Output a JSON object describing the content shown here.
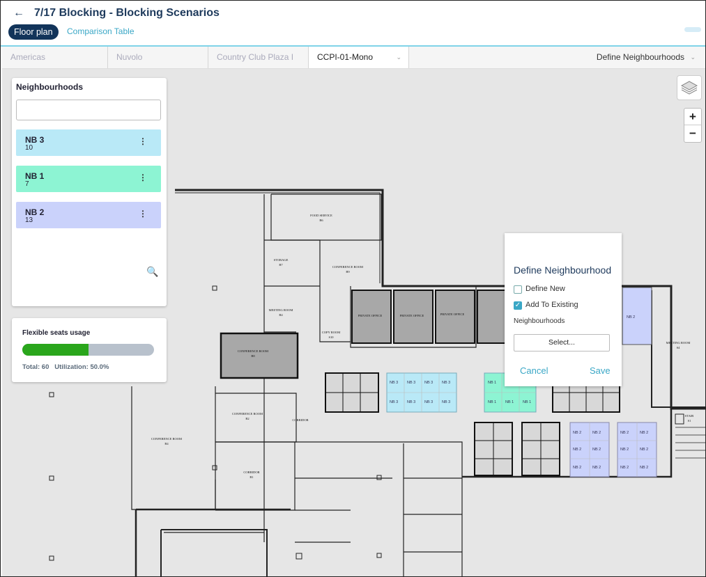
{
  "header": {
    "back_icon": "arrow-left-icon",
    "title": "7/17 Blocking - Blocking Scenarios",
    "tabs": [
      {
        "label": "Floor plan",
        "active": true
      },
      {
        "label": "Comparison Table",
        "active": false
      }
    ]
  },
  "breadcrumbs": {
    "items": [
      "Americas",
      "Nuvolo",
      "Country Club Plaza I"
    ],
    "floor": "CCPI-01-Mono",
    "mode": "Define Neighbourhoods"
  },
  "neighbourhoods": {
    "title": "Neighbourhoods",
    "search_value": "",
    "items": [
      {
        "name": "NB 3",
        "count": "10",
        "color": "#b9e9f7"
      },
      {
        "name": "NB 1",
        "count": "7",
        "color": "#8df4d3"
      },
      {
        "name": "NB 2",
        "count": "13",
        "color": "#cad2fb"
      }
    ]
  },
  "flexible_seats": {
    "title": "Flexible seats usage",
    "utilization_fraction": 0.5,
    "stats": "Total: 60   Utilization: 50.0%",
    "colors": {
      "used": "#2aa61c",
      "free": "#b8c1cc"
    }
  },
  "map_controls": {
    "layers_icon": "layers-icon",
    "zoom_in": "+",
    "zoom_out": "−"
  },
  "dialog": {
    "title": "Define Neighbourhood",
    "define_new_label": "Define New",
    "define_new_checked": false,
    "add_existing_label": "Add To Existing",
    "add_existing_checked": true,
    "neighbourhoods_label": "Neighbourhoods",
    "select_placeholder": "Select...",
    "cancel_label": "Cancel",
    "save_label": "Save"
  },
  "map_rooms": {
    "food_service": "FOOD SERVICE",
    "food_service_num": "B6",
    "storage": "STORAGE",
    "storage_num": "B7",
    "conf_b9": "CONFERENCE ROOM",
    "conf_b9_num": "B9",
    "meeting_b4": "MEETING ROOM",
    "meeting_b4_num": "B4",
    "copy_room": "COPY ROOM",
    "copy_room_num": "S10",
    "conf_b8": "CONFERENCE ROOM",
    "conf_b8_num": "B8",
    "private_office": "PRIVATE OFFICE",
    "conf_b2": "CONFERENCE ROOM",
    "conf_b2_num": "B2",
    "corridor": "CORRIDOR",
    "conf_b4b": "CONFERENCE ROOM",
    "conf_b4b_num": "B4",
    "corridor_b1": "CORRIDOR",
    "corridor_b1_num": "B1",
    "meeting_right": "MEETING ROOM",
    "meeting_right_num": "S4",
    "stair": "STAIR",
    "stair_num": "S1",
    "desk_nb3": "NB 3",
    "desk_nb1": "NB 1",
    "desk_nb2": "NB 2"
  }
}
